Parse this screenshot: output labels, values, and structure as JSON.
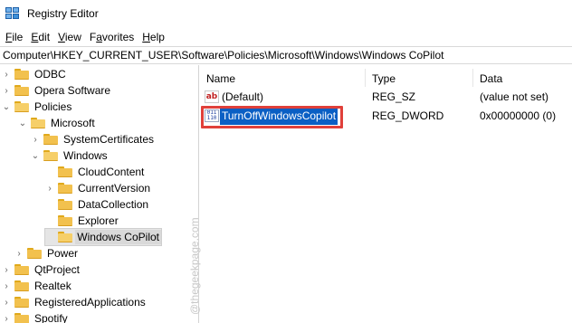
{
  "window": {
    "title": "Registry Editor",
    "icon": "registry-editor-icon"
  },
  "menu": [
    {
      "label_pre": "",
      "underline": "F",
      "label_post": "ile"
    },
    {
      "label_pre": "",
      "underline": "E",
      "label_post": "dit"
    },
    {
      "label_pre": "",
      "underline": "V",
      "label_post": "iew"
    },
    {
      "label_pre": "F",
      "underline": "a",
      "label_post": "vorites"
    },
    {
      "label_pre": "",
      "underline": "H",
      "label_post": "elp"
    }
  ],
  "address": "Computer\\HKEY_CURRENT_USER\\Software\\Policies\\Microsoft\\Windows\\Windows CoPilot",
  "tree": [
    {
      "label": "ODBC",
      "chevron": "›"
    },
    {
      "label": "Opera Software",
      "chevron": "›"
    },
    {
      "label": "Policies",
      "chevron": "⌄"
    },
    {
      "label": "Microsoft",
      "chevron": "⌄"
    },
    {
      "label": "SystemCertificates",
      "chevron": "›"
    },
    {
      "label": "Windows",
      "chevron": "⌄"
    },
    {
      "label": "CloudContent",
      "chevron": ""
    },
    {
      "label": "CurrentVersion",
      "chevron": "›"
    },
    {
      "label": "DataCollection",
      "chevron": ""
    },
    {
      "label": "Explorer",
      "chevron": ""
    },
    {
      "label": "Windows CoPilot",
      "chevron": ""
    },
    {
      "label": "Power",
      "chevron": "›"
    },
    {
      "label": "QtProject",
      "chevron": "›"
    },
    {
      "label": "Realtek",
      "chevron": "›"
    },
    {
      "label": "RegisteredApplications",
      "chevron": "›"
    },
    {
      "label": "Spotify",
      "chevron": "›"
    }
  ],
  "columns": {
    "name": "Name",
    "type": "Type",
    "data": "Data"
  },
  "values": [
    {
      "name": "(Default)",
      "type": "REG_SZ",
      "data": "(value not set)",
      "icon": "string-value-icon",
      "icon_text": "ab"
    },
    {
      "name": "TurnOffWindowsCopilot",
      "type": "REG_DWORD",
      "data": "0x00000000 (0)",
      "icon": "dword-value-icon",
      "icon_text": "011 110"
    }
  ],
  "watermark": "@thegeekpage.com",
  "colors": {
    "selection": "#0a5fc4",
    "highlight_border": "#e0403a",
    "folder": "#f2c14e"
  }
}
